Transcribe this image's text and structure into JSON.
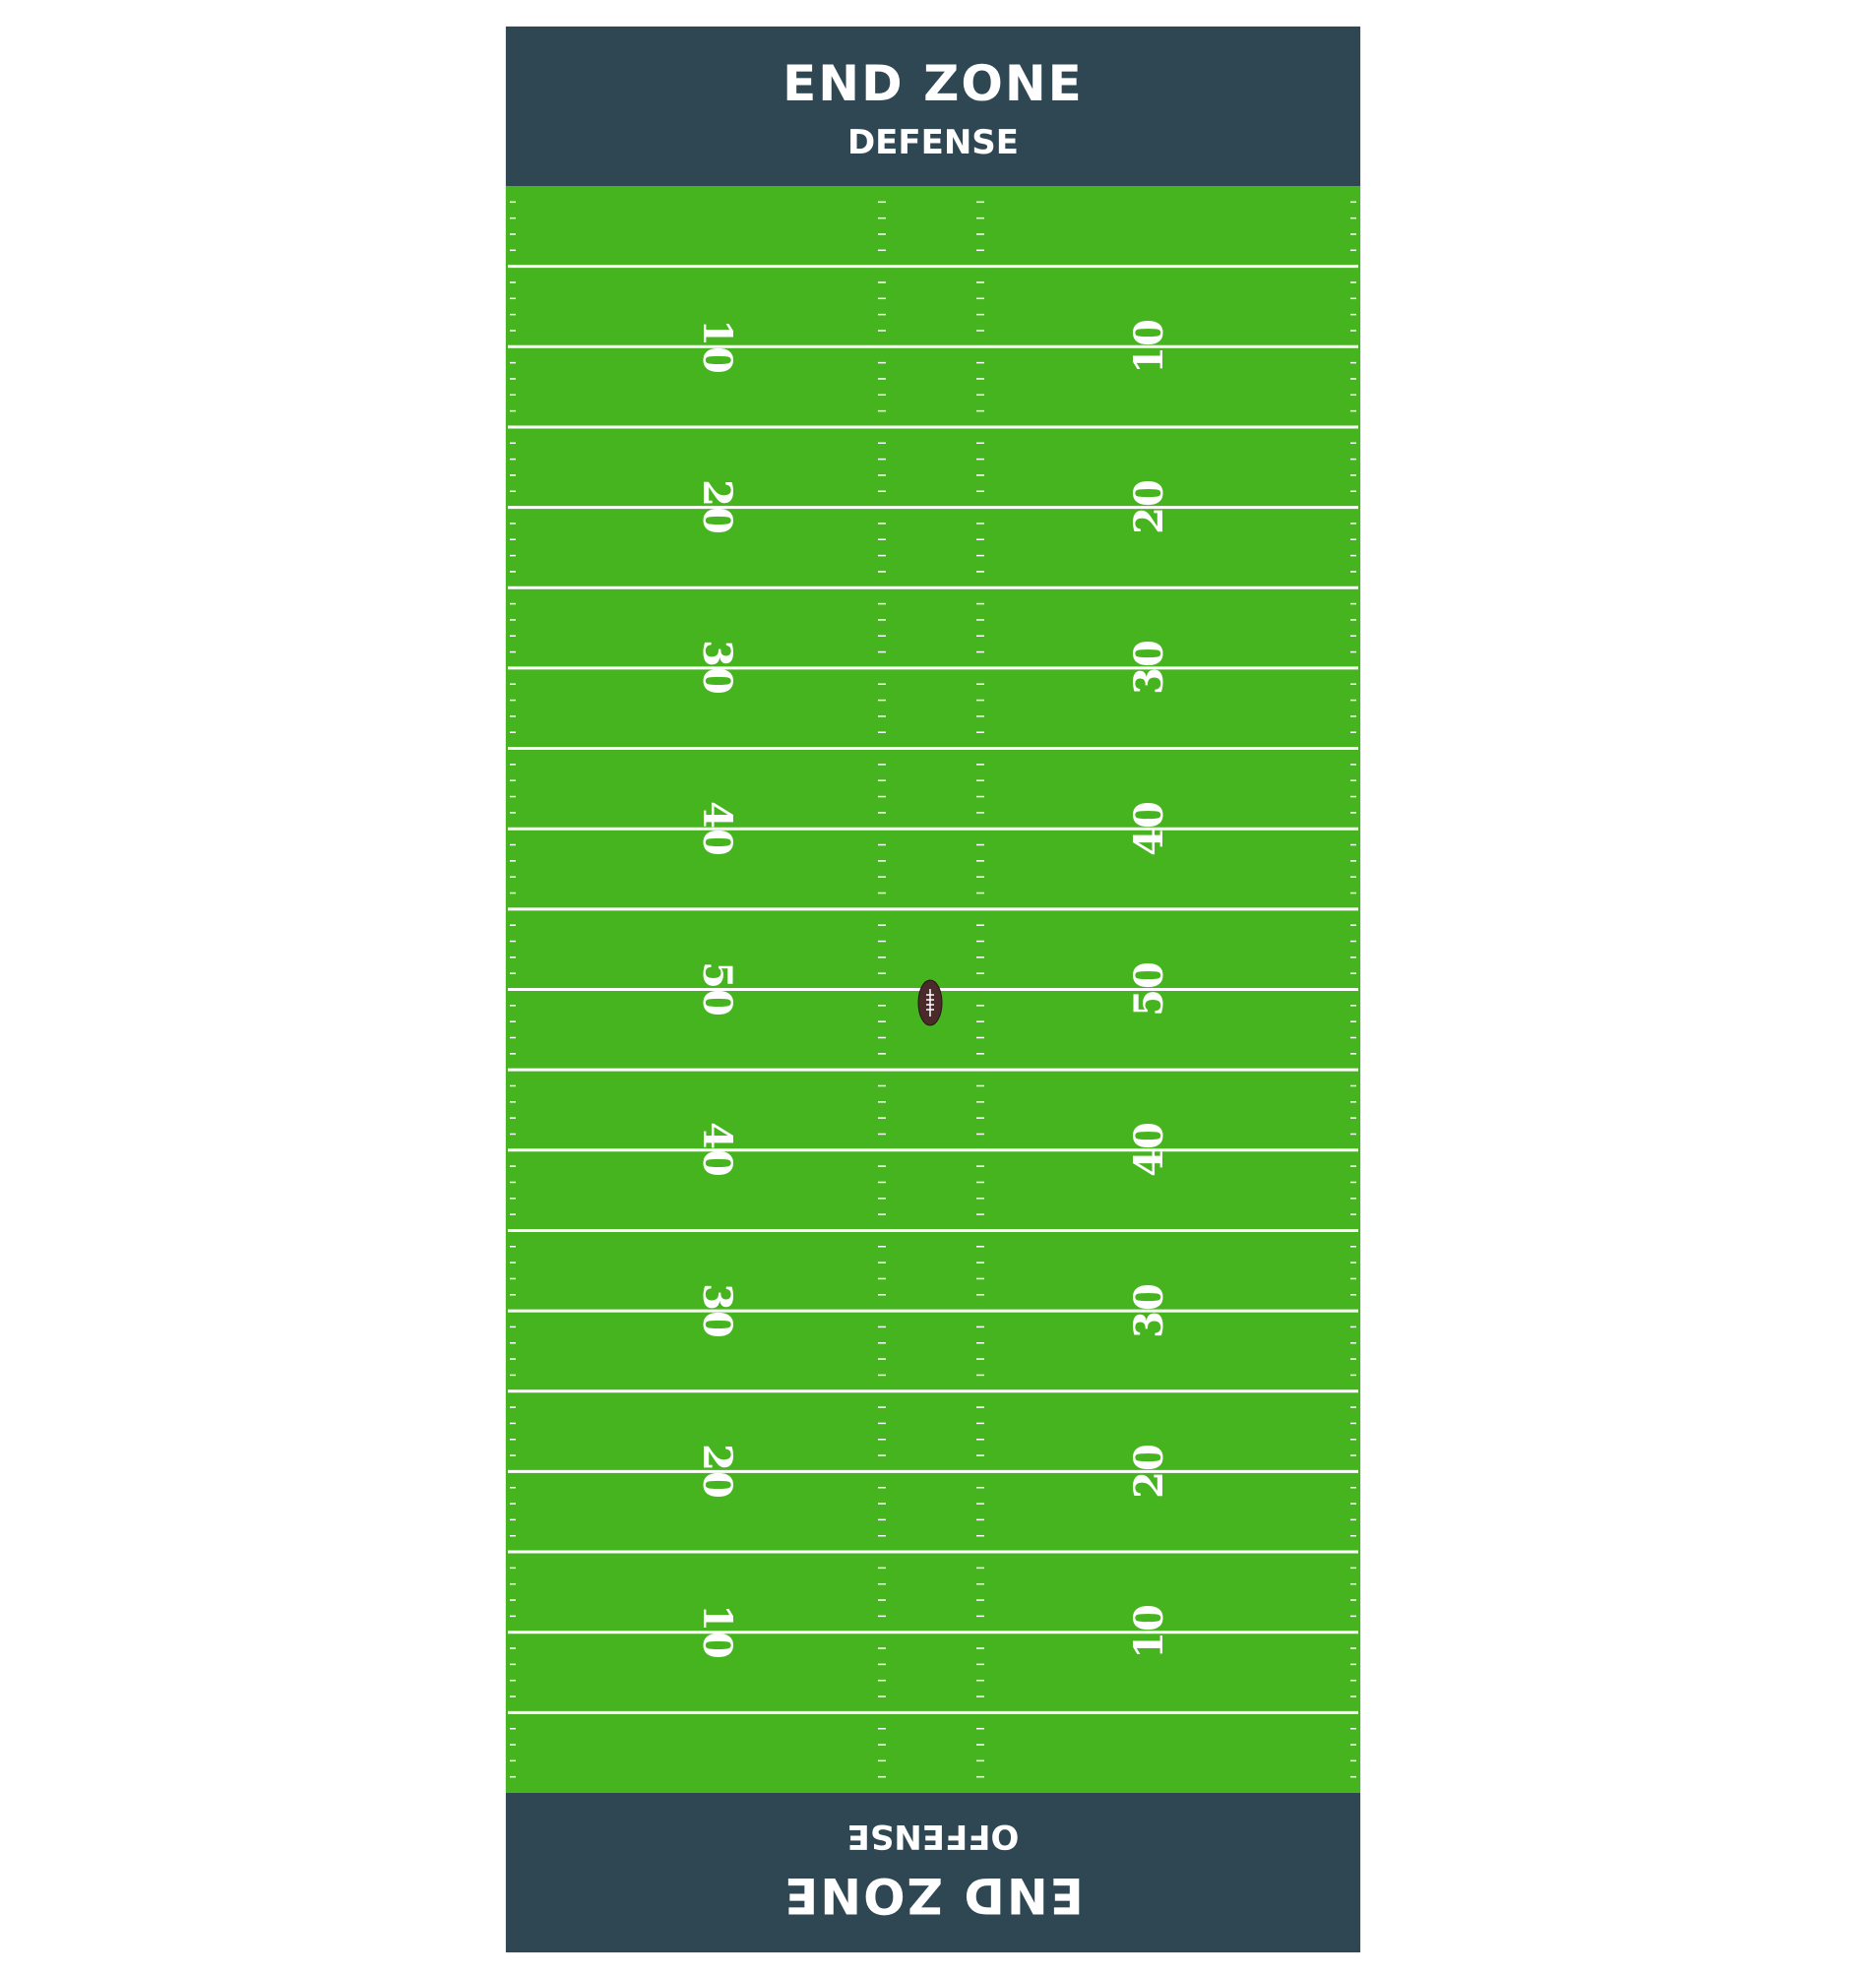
{
  "top_endzone": {
    "title": "END ZONE",
    "label": "DEFENSE"
  },
  "bottom_endzone": {
    "title": "END ZONE",
    "label": "OFFENSE"
  },
  "yard_numbers": {
    "left": [
      "10",
      "20",
      "30",
      "40",
      "50",
      "40",
      "30",
      "20",
      "10"
    ],
    "right": [
      "10",
      "20",
      "30",
      "40",
      "50",
      "40",
      "30",
      "20",
      "10"
    ]
  },
  "colors": {
    "turf": "#46b41e",
    "endzone": "#2f4753",
    "lines": "#ffffff",
    "ball": "#4a2a2a"
  },
  "icons": {
    "ball": "football-icon"
  }
}
